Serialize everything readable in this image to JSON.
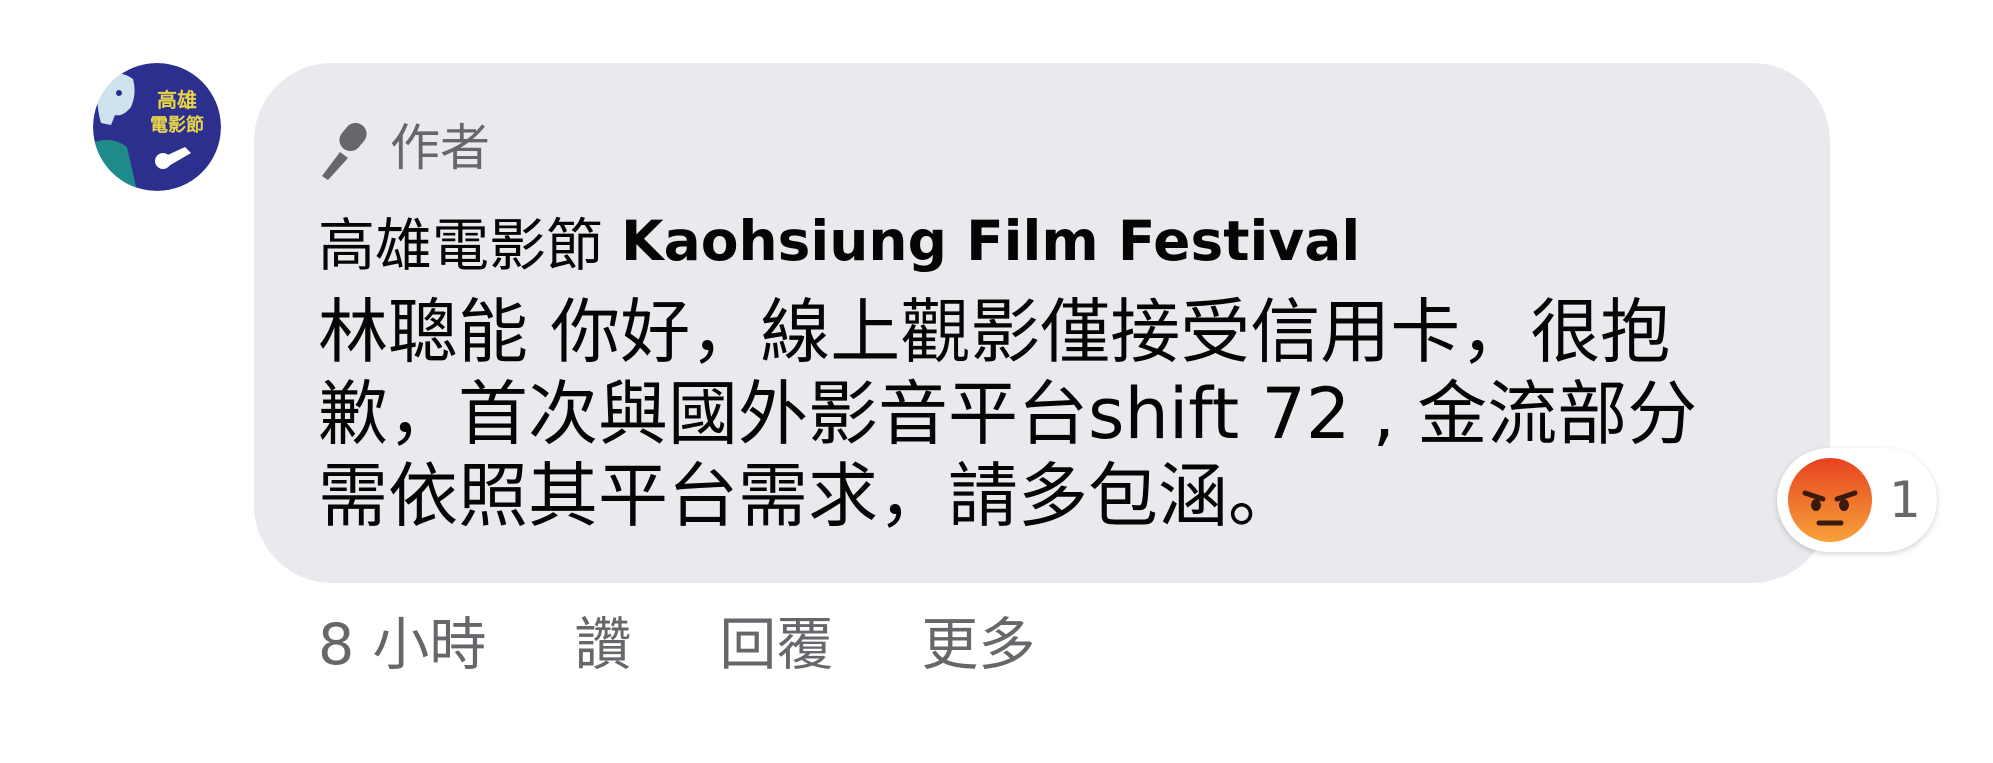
{
  "comment": {
    "avatar": {
      "text_line1": "高雄",
      "text_line2": "電影節",
      "colors": {
        "background": "#2d2f8e",
        "accent": "#e8d44a",
        "face": "#cfe3ee",
        "ring": "#1f8a8a"
      }
    },
    "author_badge": {
      "icon": "microphone-icon",
      "label": "作者"
    },
    "author_name_zh": "高雄電影節",
    "author_name_en": "Kaohsiung Film Festival",
    "text": "林聰能 你好，線上觀影僅接受信用卡，很抱\n歉，首次與國外影音平台shift 72 , 金流部分\n需依照其平台需求，請多包涵。",
    "reaction": {
      "icon": "angry-face-icon",
      "count": "1",
      "color": "#f26d2a"
    },
    "actions": {
      "timestamp": "8 小時",
      "like": "讚",
      "reply": "回覆",
      "more": "更多"
    }
  },
  "colors": {
    "bubble": "#e9eaed",
    "primary_text": "#050505",
    "secondary_text": "#65676b"
  }
}
